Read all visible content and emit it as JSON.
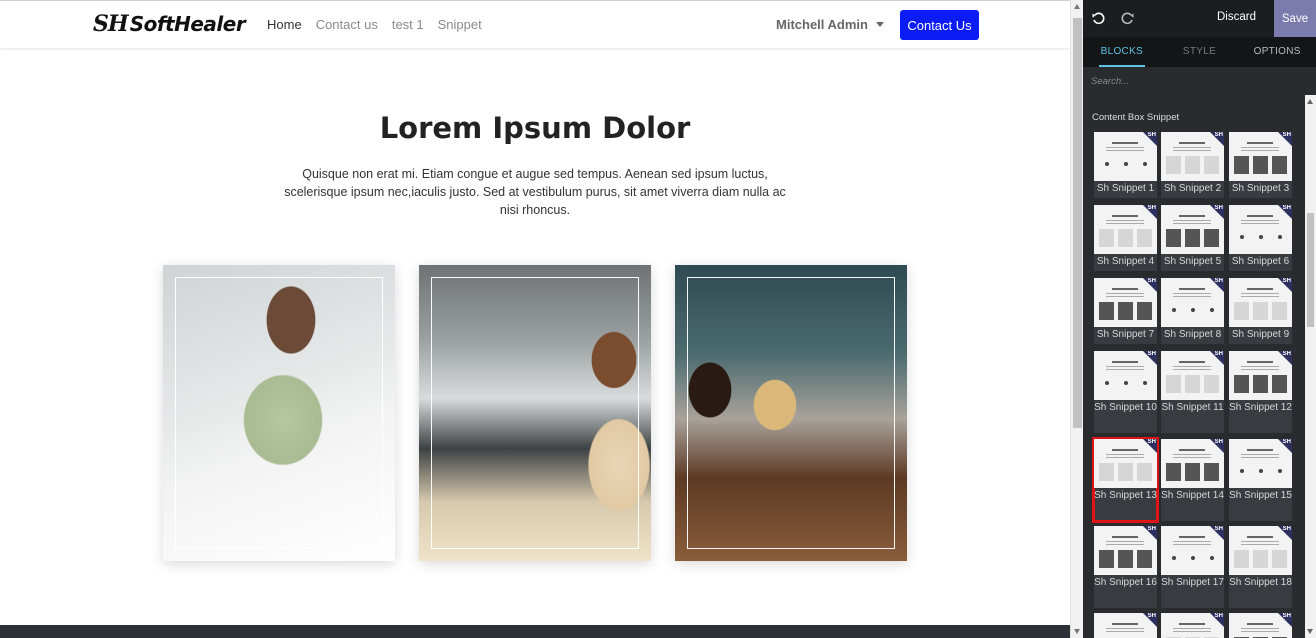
{
  "site": {
    "logo_mark": "SH",
    "logo_text": "SoftHealer",
    "nav": [
      "Home",
      "Contact us",
      "test 1",
      "Snippet"
    ],
    "user": "Mitchell Admin",
    "cta": "Contact Us",
    "hero_title": "Lorem Ipsum Dolor",
    "hero_text": "Quisque non erat mi. Etiam congue et augue sed tempus. Aenean sed ipsum luctus, scelerisque ipsum nec,iaculis justo. Sed at vestibulum purus, sit amet viverra diam nulla ac nisi rhoncus."
  },
  "editor": {
    "discard": "Discard",
    "save": "Save",
    "tabs": [
      "BLOCKS",
      "STYLE",
      "OPTIONS"
    ],
    "search_placeholder": "Search...",
    "section_title": "Content Box Snippet",
    "badge": "SH",
    "snippets": [
      "Sh Snippet 1",
      "Sh Snippet 2",
      "Sh Snippet 3",
      "Sh Snippet 4",
      "Sh Snippet 5",
      "Sh Snippet 6",
      "Sh Snippet 7",
      "Sh Snippet 8",
      "Sh Snippet 9",
      "Sh Snippet 10",
      "Sh Snippet 11",
      "Sh Snippet 12",
      "Sh Snippet 13",
      "Sh Snippet 14",
      "Sh Snippet 15",
      "Sh Snippet 16",
      "Sh Snippet 17",
      "Sh Snippet 18"
    ],
    "selected_snippet": "Sh Snippet 13"
  },
  "colors": {
    "cta": "#0b1cf5",
    "save": "#7c7bad",
    "active_tab": "#5fc5e8",
    "selected_outline": "#e01414"
  }
}
